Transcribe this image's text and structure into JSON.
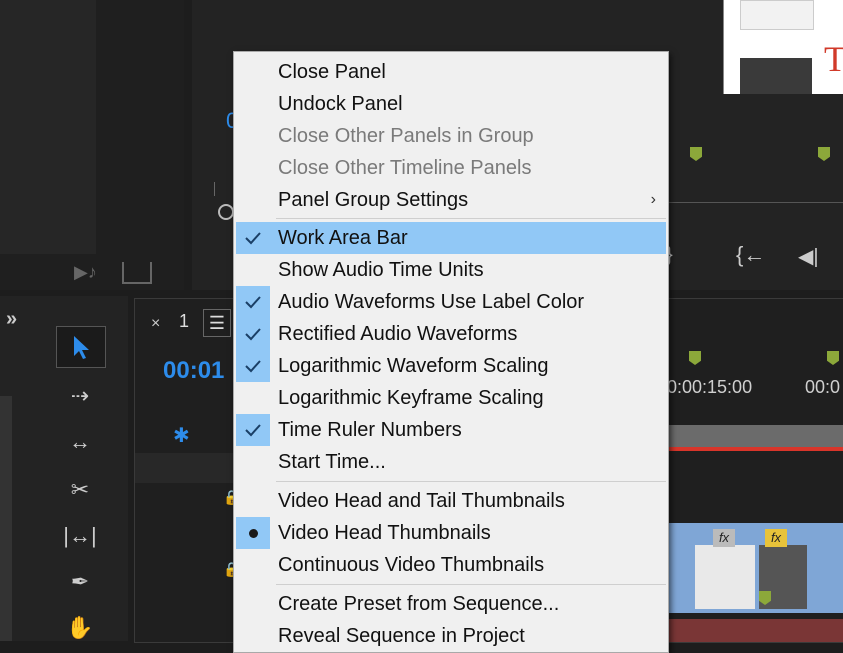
{
  "timeline": {
    "tab_number": "1",
    "timecode": "00:01",
    "source_timecode_partial": "0",
    "ruler_labels": [
      "0:00:15:00",
      "00:0"
    ]
  },
  "thumbnail": {
    "letter": "T"
  },
  "clip_badges": [
    "fx",
    "fx"
  ],
  "context_menu": {
    "items": [
      {
        "label": "Close Panel",
        "state": "enabled"
      },
      {
        "label": "Undock Panel",
        "state": "enabled"
      },
      {
        "label": "Close Other Panels in Group",
        "state": "disabled"
      },
      {
        "label": "Close Other Timeline Panels",
        "state": "disabled"
      },
      {
        "label": "Panel Group Settings",
        "state": "submenu"
      },
      {
        "label": "Work Area Bar",
        "state": "checked-highlighted"
      },
      {
        "label": "Show Audio Time Units",
        "state": "enabled"
      },
      {
        "label": "Audio Waveforms Use Label Color",
        "state": "checked"
      },
      {
        "label": "Rectified Audio Waveforms",
        "state": "checked"
      },
      {
        "label": "Logarithmic Waveform Scaling",
        "state": "checked"
      },
      {
        "label": "Logarithmic Keyframe Scaling",
        "state": "enabled"
      },
      {
        "label": "Time Ruler Numbers",
        "state": "checked"
      },
      {
        "label": "Start Time...",
        "state": "enabled"
      },
      {
        "label": "Video Head and Tail Thumbnails",
        "state": "enabled"
      },
      {
        "label": "Video Head Thumbnails",
        "state": "radio-selected"
      },
      {
        "label": "Continuous Video Thumbnails",
        "state": "enabled"
      },
      {
        "label": "Create Preset from Sequence...",
        "state": "enabled"
      },
      {
        "label": "Reveal Sequence in Project",
        "state": "enabled"
      }
    ]
  },
  "colors": {
    "menu_bg": "#f0f0f0",
    "highlight": "#91c8f6",
    "timecode_blue": "#2d8ceb",
    "marker_green": "#8ca83a",
    "playhead_red": "#d9352a"
  }
}
